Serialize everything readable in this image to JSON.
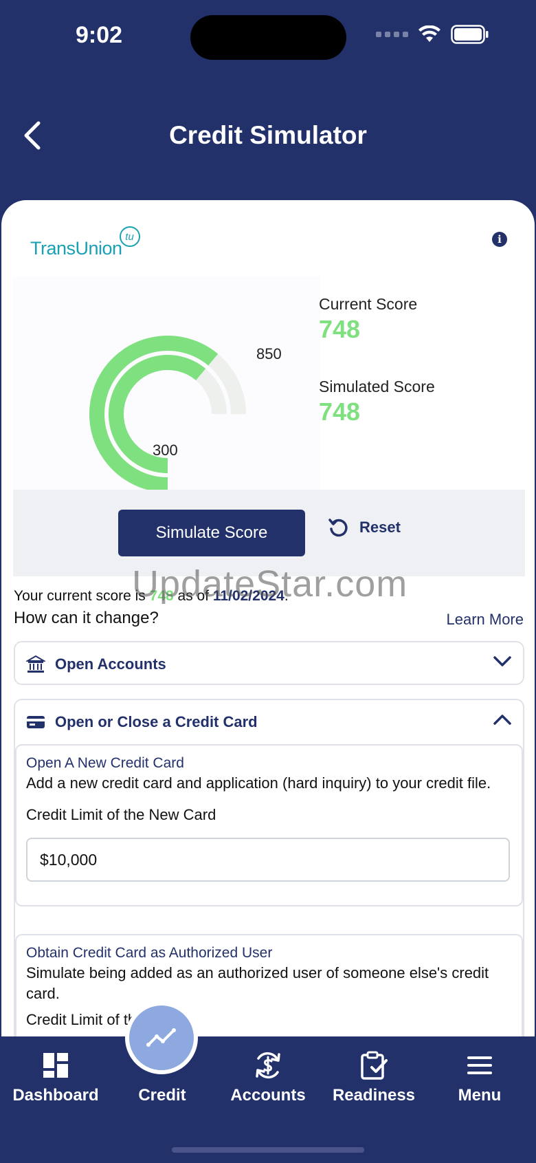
{
  "status_bar": {
    "time": "9:02"
  },
  "header": {
    "title": "Credit Simulator"
  },
  "brand": {
    "logo_text": "TransUnion",
    "logo_badge": "tu",
    "info_symbol": "i"
  },
  "gauge": {
    "min_label": "300",
    "max_label": "850",
    "min": 300,
    "max": 850,
    "current": 748,
    "simulated": 748,
    "fill_color": "#7ee07e",
    "track_color": "#eef0ee"
  },
  "scores": {
    "current_label": "Current Score",
    "current_value": "748",
    "simulated_label": "Simulated Score",
    "simulated_value": "748"
  },
  "actions": {
    "simulate_label": "Simulate Score",
    "reset_label": "Reset"
  },
  "summary": {
    "prefix": "Your current score is ",
    "score": "748",
    "middle": " as of ",
    "date": "11/02/2024",
    "suffix": ".",
    "question": "How can it change?",
    "learn_more": "Learn More"
  },
  "sections": [
    {
      "title": "Open Accounts",
      "expanded": false,
      "icon": "bank-icon"
    },
    {
      "title": "Open or Close a Credit Card",
      "expanded": true,
      "icon": "credit-card-icon"
    }
  ],
  "new_card": {
    "title": "Open A New Credit Card",
    "description": "Add a new credit card and application (hard inquiry) to your credit file.",
    "field_label": "Credit Limit of the New Card",
    "field_value": "$10,000"
  },
  "authorized_user": {
    "title": "Obtain Credit Card as Authorized User",
    "description": "Simulate being added as an authorized user of someone else's credit card.",
    "field_label": "Credit Limit of the Card"
  },
  "watermark": "UpdateStar.com",
  "tabs": [
    {
      "label": "Dashboard",
      "icon": "dashboard-icon"
    },
    {
      "label": "Credit",
      "icon": "trend-icon",
      "active": true
    },
    {
      "label": "Accounts",
      "icon": "accounts-icon"
    },
    {
      "label": "Readiness",
      "icon": "clipboard-check-icon"
    },
    {
      "label": "Menu",
      "icon": "hamburger-icon"
    }
  ],
  "colors": {
    "navy": "#23316b",
    "accent_green": "#7ee07e",
    "brand_teal": "#1aa0b4",
    "active_tab": "#8ea8e0"
  }
}
